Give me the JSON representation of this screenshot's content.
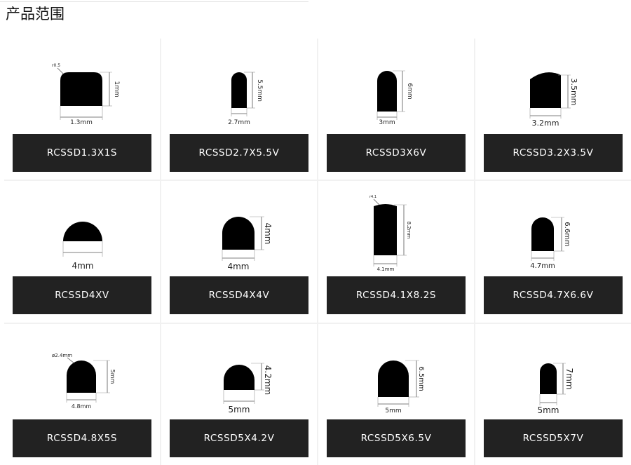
{
  "page": {
    "title": "产品范围"
  },
  "colors": {
    "label_bar": "#222222",
    "label_text": "#ffffff",
    "shape_fill": "#000000",
    "grid_divider": "#f1f1f1"
  },
  "products": [
    {
      "name": "RCSSD1.3X1S",
      "width_label": "1.3mm",
      "height_label": "1mm",
      "radius_label": "r0.5"
    },
    {
      "name": "RCSSD2.7X5.5V",
      "width_label": "2.7mm",
      "height_label": "5.5mm"
    },
    {
      "name": "RCSSD3X6V",
      "width_label": "3mm",
      "height_label": "6mm"
    },
    {
      "name": "RCSSD3.2X3.5V",
      "width_label": "3.2mm",
      "height_label": "3.5mm"
    },
    {
      "name": "RCSSD4XV",
      "width_label": "4mm"
    },
    {
      "name": "RCSSD4X4V",
      "width_label": "4mm",
      "height_label": "4mm"
    },
    {
      "name": "RCSSD4.1X8.2S",
      "width_label": "4.1mm",
      "height_label": "8.2mm",
      "radius_label": "r4.1"
    },
    {
      "name": "RCSSD4.7X6.6V",
      "width_label": "4.7mm",
      "height_label": "6.6mm"
    },
    {
      "name": "RCSSD4.8X5S",
      "width_label": "4.8mm",
      "height_label": "5mm",
      "radius_label": "ø2.4mm"
    },
    {
      "name": "RCSSD5X4.2V",
      "width_label": "5mm",
      "height_label": "4.2mm"
    },
    {
      "name": "RCSSD5X6.5V",
      "width_label": "5mm",
      "height_label": "6.5mm"
    },
    {
      "name": "RCSSD5X7V",
      "width_label": "5mm",
      "height_label": "7mm"
    }
  ]
}
